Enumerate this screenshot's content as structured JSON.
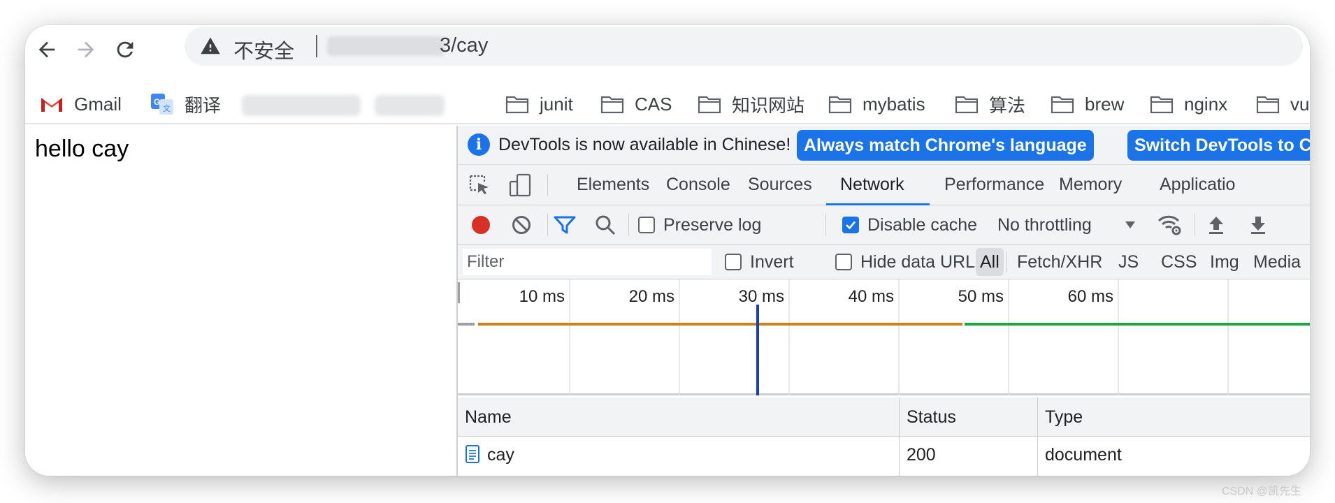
{
  "browser": {
    "address_bar": {
      "security_label": "不安全",
      "url_visible": "3/cay"
    },
    "bookmarks": [
      {
        "label": "Gmail",
        "icon": "gmail-icon"
      },
      {
        "label": "翻译",
        "icon": "translate-icon"
      },
      {
        "label": "junit",
        "icon": "folder-icon"
      },
      {
        "label": "CAS",
        "icon": "folder-icon"
      },
      {
        "label": "知识网站",
        "icon": "folder-icon"
      },
      {
        "label": "mybatis",
        "icon": "folder-icon"
      },
      {
        "label": "算法",
        "icon": "folder-icon"
      },
      {
        "label": "brew",
        "icon": "folder-icon"
      },
      {
        "label": "nginx",
        "icon": "folder-icon"
      },
      {
        "label": "vu",
        "icon": "folder-icon"
      }
    ]
  },
  "page": {
    "text": "hello cay"
  },
  "devtools": {
    "infobar": {
      "message": "DevTools is now available in Chinese!",
      "primary_button": "Always match Chrome's language",
      "secondary_button": "Switch DevTools to Chine"
    },
    "tabs": [
      "Elements",
      "Console",
      "Sources",
      "Network",
      "Performance",
      "Memory",
      "Applicatio"
    ],
    "active_tab": "Network",
    "network_toolbar": {
      "preserve_log_label": "Preserve log",
      "preserve_log_checked": false,
      "disable_cache_label": "Disable cache",
      "disable_cache_checked": true,
      "throttling": "No throttling"
    },
    "filter_bar": {
      "placeholder": "Filter",
      "invert_label": "Invert",
      "hide_data_urls_label": "Hide data URLs",
      "types": [
        "All",
        "Fetch/XHR",
        "JS",
        "CSS",
        "Img",
        "Media"
      ],
      "active_type": "All"
    },
    "timeline": {
      "ticks": [
        "10 ms",
        "20 ms",
        "30 ms",
        "40 ms",
        "50 ms",
        "60 ms"
      ],
      "waiting_color": "#d17f17",
      "download_color": "#1ea446",
      "dom_content_loaded_color": "#1a3fb5"
    },
    "requests_table": {
      "columns": [
        "Name",
        "Status",
        "Type"
      ],
      "rows": [
        {
          "name": "cay",
          "status": "200",
          "type": "document"
        }
      ]
    }
  },
  "watermark": "CSDN @凯先生"
}
